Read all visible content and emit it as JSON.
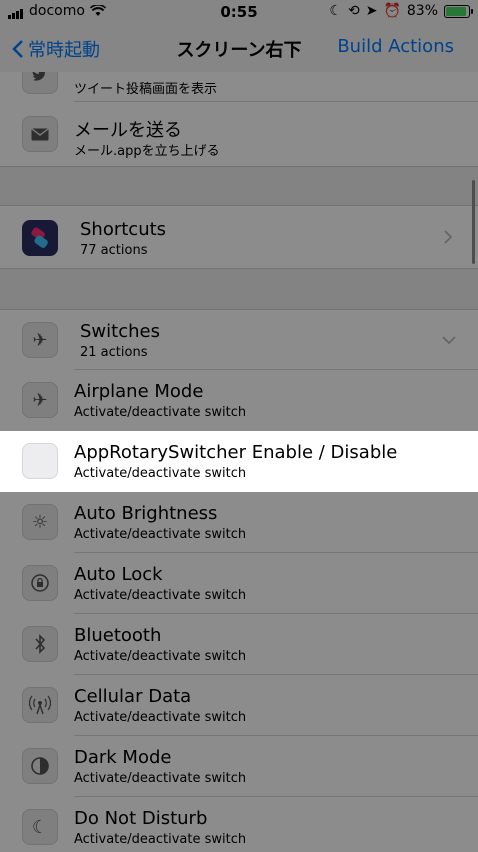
{
  "status_bar": {
    "carrier": "docomo",
    "time": "0:55",
    "battery_percent": "83%",
    "battery_level": 0.83,
    "battery_color": "#4cd964"
  },
  "nav": {
    "back_label": "常時起動",
    "title": "スクリーン右下",
    "action_label": "Build Actions",
    "accent_color": "#007aff"
  },
  "list": {
    "top_partial": {
      "subtitle": "ツイート投稿画面を表示",
      "icon": "twitter-icon"
    },
    "send_mail": {
      "title": "メールを送る",
      "subtitle": "メール.appを立ち上げる",
      "icon": "mail-icon"
    },
    "shortcuts": {
      "title": "Shortcuts",
      "subtitle": "77 actions",
      "icon": "shortcuts-app-icon"
    },
    "switches": {
      "title": "Switches",
      "subtitle": "21 actions",
      "icon": "airplane-icon"
    },
    "items": [
      {
        "title": "Airplane Mode",
        "subtitle": "Activate/deactivate switch",
        "icon": "airplane-icon"
      },
      {
        "title": "AppRotarySwitcher Enable / Disable",
        "subtitle": "Activate/deactivate switch",
        "icon": "blank-icon",
        "highlighted": true
      },
      {
        "title": "Auto Brightness",
        "subtitle": "Activate/deactivate switch",
        "icon": "brightness-icon"
      },
      {
        "title": "Auto Lock",
        "subtitle": "Activate/deactivate switch",
        "icon": "lock-icon"
      },
      {
        "title": "Bluetooth",
        "subtitle": "Activate/deactivate switch",
        "icon": "bluetooth-icon"
      },
      {
        "title": "Cellular Data",
        "subtitle": "Activate/deactivate switch",
        "icon": "cellular-icon"
      },
      {
        "title": "Dark Mode",
        "subtitle": "Activate/deactivate switch",
        "icon": "dark-mode-icon"
      },
      {
        "title": "Do Not Disturb",
        "subtitle": "Activate/deactivate switch",
        "icon": "moon-icon"
      }
    ]
  }
}
